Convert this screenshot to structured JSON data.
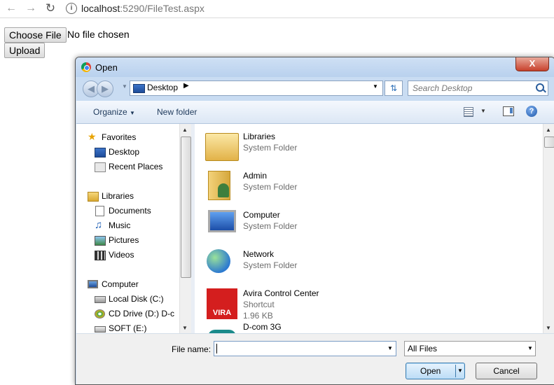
{
  "browser": {
    "back_icon": "arrow-left-icon",
    "forward_icon": "arrow-right-icon",
    "reload_icon": "reload-icon",
    "url_host": "localhost",
    "url_rest": ":5290/FileTest.aspx"
  },
  "page": {
    "choose_file_label": "Choose File",
    "no_file_text": "No file chosen",
    "upload_label": "Upload"
  },
  "dialog": {
    "title": "Open",
    "close_label": "X",
    "address": "Desktop",
    "search_placeholder": "Search Desktop",
    "commands": {
      "organize": "Organize",
      "new_folder": "New folder"
    },
    "nav": {
      "items": [
        {
          "label": "Favorites",
          "icon": "star-icon",
          "group": true
        },
        {
          "label": "Desktop",
          "icon": "desktop-icon"
        },
        {
          "label": "Recent Places",
          "icon": "recent-places-icon"
        },
        {
          "label": "Libraries",
          "icon": "libraries-icon",
          "group": true
        },
        {
          "label": "Documents",
          "icon": "documents-icon"
        },
        {
          "label": "Music",
          "icon": "music-icon"
        },
        {
          "label": "Pictures",
          "icon": "pictures-icon"
        },
        {
          "label": "Videos",
          "icon": "videos-icon"
        },
        {
          "label": "Computer",
          "icon": "computer-icon",
          "group": true
        },
        {
          "label": "Local Disk (C:)",
          "icon": "local-disk-icon"
        },
        {
          "label": "CD Drive (D:) D-c",
          "icon": "cd-drive-icon"
        },
        {
          "label": "SOFT (E:)",
          "icon": "drive-icon"
        }
      ]
    },
    "files": [
      {
        "name": "Libraries",
        "type": "System Folder",
        "icon": "libraries-folder-icon"
      },
      {
        "name": "Admin",
        "type": "System Folder",
        "icon": "user-folder-icon"
      },
      {
        "name": "Computer",
        "type": "System Folder",
        "icon": "computer-icon"
      },
      {
        "name": "Network",
        "type": "System Folder",
        "icon": "network-icon"
      },
      {
        "name": "Avira Control Center",
        "type": "Shortcut",
        "size": "1.96 KB",
        "icon": "avira-icon"
      },
      {
        "name": "D-com 3G",
        "icon": "dcom-icon"
      }
    ],
    "file_name_label": "File name:",
    "file_name_value": "",
    "file_type": "All Files",
    "open_label": "Open",
    "cancel_label": "Cancel"
  },
  "colors": {
    "dialog_frame": "#c9dcf2",
    "close_red": "#c8412b",
    "link_blue": "#1e395b"
  }
}
